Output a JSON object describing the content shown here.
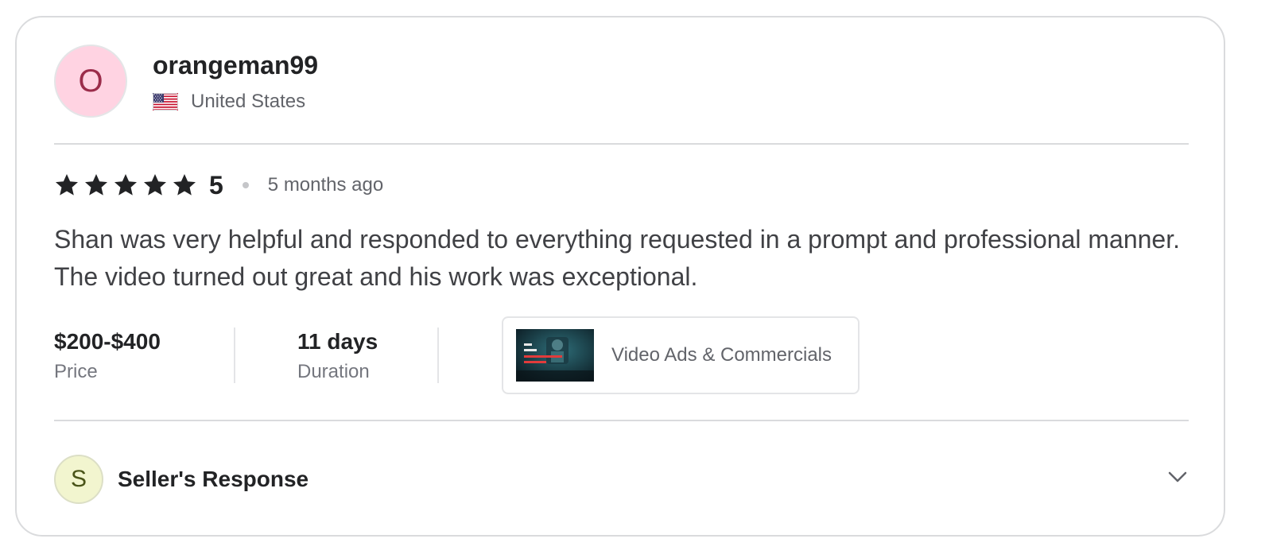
{
  "reviewer": {
    "avatar_letter": "O",
    "username": "orangeman99",
    "country": "United States",
    "flag_icon": "us-flag-icon"
  },
  "review": {
    "rating": "5",
    "star_count": 5,
    "time_ago": "5 months ago",
    "text": "Shan was very helpful and responded to everything requested in a prompt and professional manner. The video turned out great and his work was exceptional."
  },
  "meta": {
    "price_value": "$200-$400",
    "price_label": "Price",
    "duration_value": "11 days",
    "duration_label": "Duration",
    "gig_category": "Video Ads & Commercials"
  },
  "seller_response": {
    "avatar_letter": "S",
    "label": "Seller's Response",
    "expanded": false
  },
  "colors": {
    "reviewer_avatar_bg": "#ffd3e2",
    "seller_avatar_bg": "#f2f5cf",
    "star": "#222325"
  }
}
